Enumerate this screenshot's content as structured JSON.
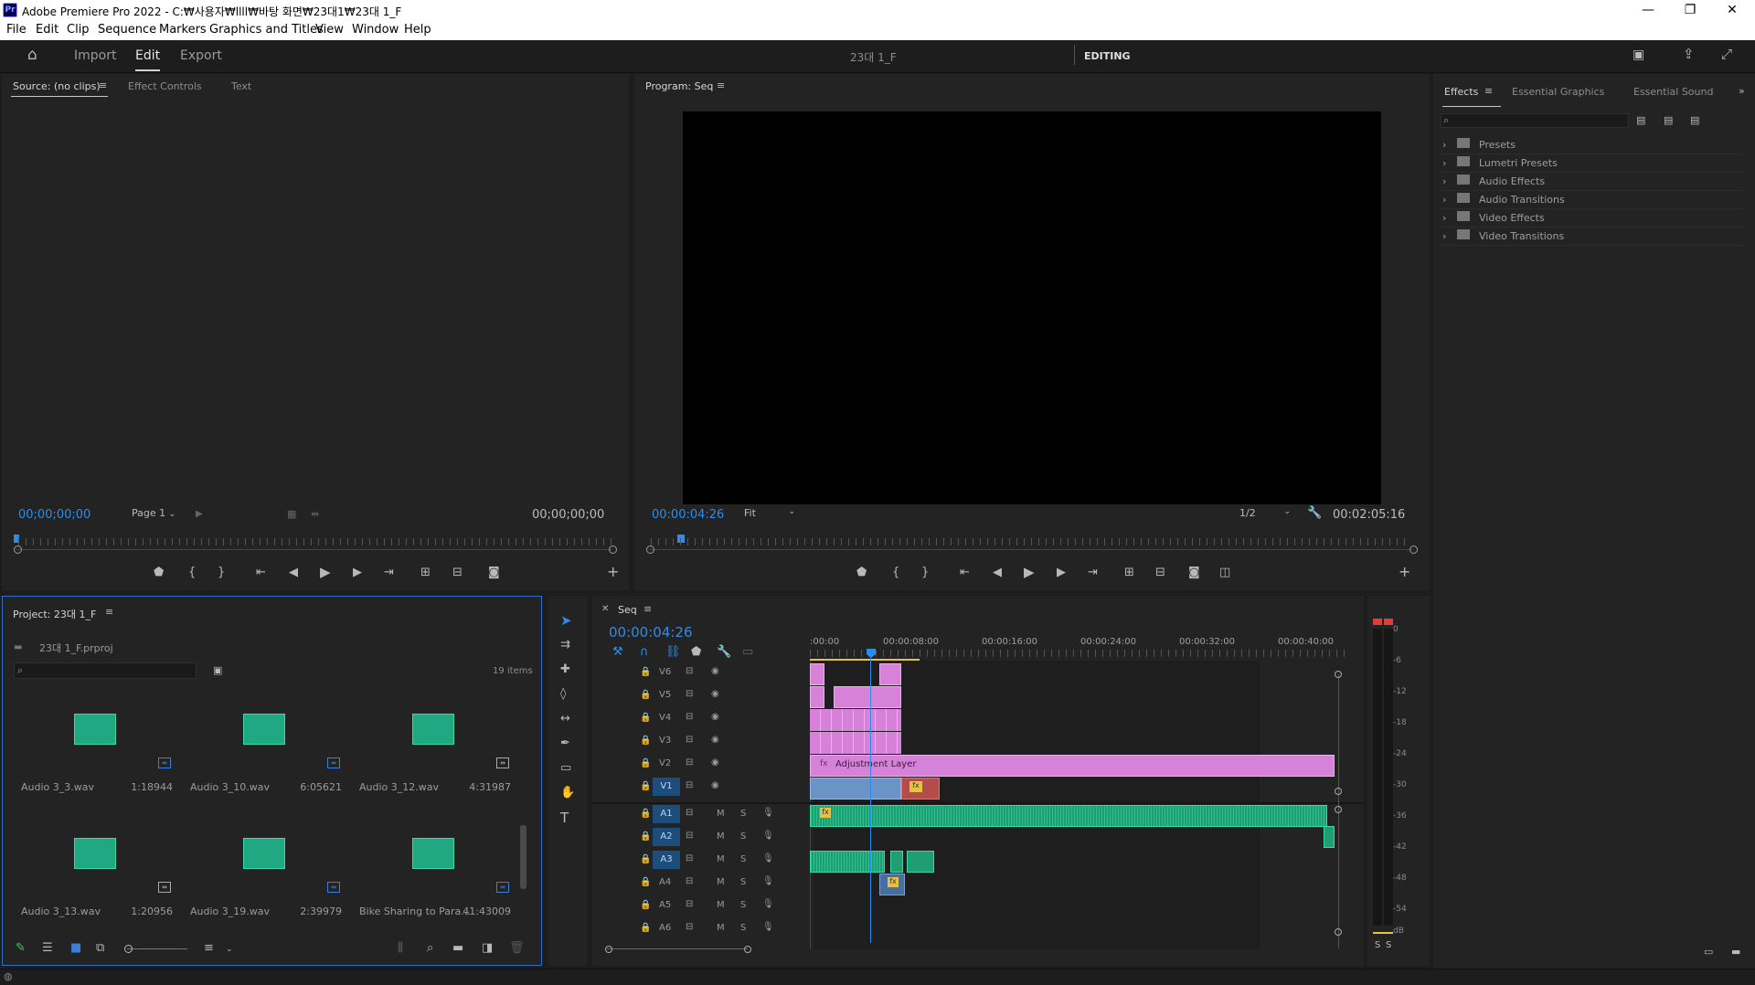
{
  "window": {
    "title": "Adobe Premiere Pro 2022 - C:₩사용자₩llll₩바탕 화면₩23대1₩23대 1_F",
    "app_badge": "Pr",
    "minimize": "—",
    "maximize": "❐",
    "close": "✕"
  },
  "menu": [
    "File",
    "Edit",
    "Clip",
    "Sequence",
    "Markers",
    "Graphics and Titles",
    "View",
    "Window",
    "Help"
  ],
  "header": {
    "workspaces": [
      "Import",
      "Edit",
      "Export"
    ],
    "active_workspace": "Edit",
    "project_title": "23대 1_F",
    "mode_label": "EDITING"
  },
  "source": {
    "tabs": [
      "Source: (no clips)",
      "Effect Controls",
      "Text"
    ],
    "timecode_left": "00;00;00;00",
    "timecode_right": "00;00;00;00",
    "page_select": "Page 1"
  },
  "program": {
    "tab": "Program: Seq",
    "timecode": "00:00:04:26",
    "fit": "Fit",
    "resolution": "1/2",
    "duration": "00:02:05:16",
    "playhead_fraction": 0.04
  },
  "effects": {
    "tabs": [
      "Effects",
      "Essential Graphics",
      "Essential Sound"
    ],
    "folders": [
      "Presets",
      "Lumetri Presets",
      "Audio Effects",
      "Audio Transitions",
      "Video Effects",
      "Video Transitions"
    ]
  },
  "project": {
    "tab": "Project: 23대 1_F",
    "file": "23대 1_F.prproj",
    "items_count": "19 items",
    "items": [
      {
        "name": "Audio 3_3.wav",
        "duration": "1:18944"
      },
      {
        "name": "Audio 3_10.wav",
        "duration": "6:05621"
      },
      {
        "name": "Audio 3_12.wav",
        "duration": "4:31987"
      },
      {
        "name": "Audio 3_13.wav",
        "duration": "1:20956"
      },
      {
        "name": "Audio 3_19.wav",
        "duration": "2:39979"
      },
      {
        "name": "Bike Sharing to Para...",
        "duration": "41:43009"
      }
    ]
  },
  "timeline": {
    "tab": "Seq",
    "timecode": "00:00:04:26",
    "ruler_labels": [
      ":00:00",
      "00:00:08:00",
      "00:00:16:00",
      "00:00:24:00",
      "00:00:32:00",
      "00:00:40:00"
    ],
    "video_tracks": [
      "V6",
      "V5",
      "V4",
      "V3",
      "V2",
      "V1"
    ],
    "audio_tracks": [
      "A1",
      "A2",
      "A3",
      "A4",
      "A5",
      "A6"
    ],
    "adjustment_layer": "Adjustment Layer",
    "fx_label": "fx",
    "mute": "M",
    "solo": "S"
  },
  "meter": {
    "labels": [
      "0",
      "-6",
      "-12",
      "-18",
      "-24",
      "-30",
      "-36",
      "-42",
      "-48",
      "-54",
      "dB"
    ],
    "solo_labels": [
      "S",
      "S"
    ]
  },
  "colors": {
    "accent_blue": "#2d8ceb",
    "video_clip": "#d782d9",
    "audio_clip": "#1f9e74",
    "v1_clip": "#6b93c6",
    "red_clip": "#b54c4c"
  }
}
